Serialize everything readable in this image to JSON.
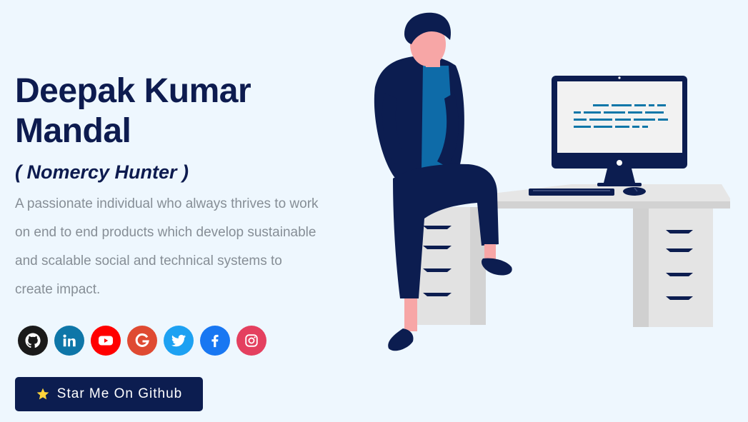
{
  "greeting": {
    "name": "Deepak Kumar Mandal",
    "nickname": "( Nomercy Hunter )",
    "subtitle": "A passionate individual who always thrives to work on end to end products which develop sustainable and scalable social and technical systems to create impact."
  },
  "socials": [
    {
      "icon": "github-icon",
      "color": "#1a1a1a"
    },
    {
      "icon": "linkedin-icon",
      "color": "#0e76a8"
    },
    {
      "icon": "youtube-icon",
      "color": "#ff0000"
    },
    {
      "icon": "google-icon",
      "color": "#df4a32"
    },
    {
      "icon": "twitter-icon",
      "color": "#1da1f2"
    },
    {
      "icon": "facebook-icon",
      "color": "#1877f2"
    },
    {
      "icon": "instagram-icon",
      "color": "#e4405f"
    }
  ],
  "cta": {
    "label": "Star Me On Github",
    "icon": "star-icon",
    "background": "#0c1d50"
  },
  "colors": {
    "background": "#eef7fe",
    "heading": "#0d1b4f",
    "subtitle": "#868e96"
  }
}
